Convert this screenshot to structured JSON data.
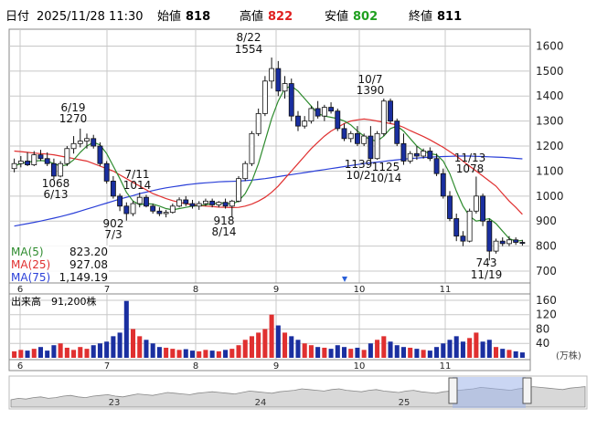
{
  "header": {
    "date_label": "日付",
    "date_value": "2025/11/28 11:30",
    "open_label": "始値",
    "open_value": "818",
    "high_label": "高値",
    "high_value": "822",
    "low_label": "安値",
    "low_value": "802",
    "close_label": "終値",
    "close_value": "811"
  },
  "colors": {
    "up": "#ffffff",
    "down": "#1a2fa0",
    "ma5": "#2e8b2e",
    "ma25": "#e03030",
    "ma75": "#2a3fd8",
    "vol_up": "#e03030",
    "vol_down": "#1a2fa0",
    "grid": "#c8c8c8",
    "high_text": "#e02020",
    "low_text": "#20a020"
  },
  "ma_legend": [
    {
      "label": "MA(5)",
      "value": "823.20"
    },
    {
      "label": "MA(25)",
      "value": "927.08"
    },
    {
      "label": "MA(75)",
      "value": "1,149.19"
    }
  ],
  "volume_label": "出来高",
  "volume_value": "91,200株",
  "volume_unit": "(万株)",
  "chart_data": {
    "type": "candlestick",
    "price_axis": {
      "ticks": [
        1600,
        1500,
        1400,
        1300,
        1200,
        1100,
        1000,
        900,
        800,
        700
      ],
      "range": [
        660,
        1660
      ]
    },
    "volume_axis": {
      "ticks": [
        160,
        120,
        80,
        40
      ],
      "range": [
        0,
        170
      ]
    },
    "month_labels": [
      "6",
      "7",
      "8",
      "9",
      "10",
      "11"
    ],
    "navigator_labels": [
      "23",
      "24",
      "25"
    ],
    "annotations": [
      {
        "date": "6/19",
        "value": "1270"
      },
      {
        "date": "6/13",
        "value": "1068"
      },
      {
        "date": "7/11",
        "value": "1014"
      },
      {
        "date": "7/3",
        "value": "902"
      },
      {
        "date": "8/14",
        "value": "918"
      },
      {
        "date": "8/22",
        "value": "1554"
      },
      {
        "date": "10/7",
        "value": "1390"
      },
      {
        "date": "10/2",
        "value": "1139"
      },
      {
        "date": "10/14",
        "value": "1125"
      },
      {
        "date": "11/13",
        "value": "1078"
      },
      {
        "date": "11/19",
        "value": "743"
      }
    ],
    "ohlc": [
      [
        1110,
        1150,
        1095,
        1130
      ],
      [
        1130,
        1160,
        1115,
        1140
      ],
      [
        1140,
        1175,
        1120,
        1125
      ],
      [
        1125,
        1180,
        1120,
        1165
      ],
      [
        1165,
        1185,
        1140,
        1150
      ],
      [
        1150,
        1175,
        1120,
        1130
      ],
      [
        1130,
        1150,
        1068,
        1080
      ],
      [
        1080,
        1140,
        1075,
        1130
      ],
      [
        1130,
        1200,
        1120,
        1190
      ],
      [
        1190,
        1240,
        1170,
        1210
      ],
      [
        1210,
        1270,
        1195,
        1220
      ],
      [
        1220,
        1250,
        1190,
        1230
      ],
      [
        1230,
        1245,
        1190,
        1200
      ],
      [
        1200,
        1215,
        1120,
        1130
      ],
      [
        1130,
        1140,
        1050,
        1060
      ],
      [
        1060,
        1080,
        990,
        1000
      ],
      [
        1000,
        1010,
        940,
        960
      ],
      [
        960,
        975,
        902,
        930
      ],
      [
        930,
        980,
        920,
        970
      ],
      [
        970,
        1014,
        955,
        995
      ],
      [
        995,
        1005,
        955,
        960
      ],
      [
        960,
        970,
        930,
        940
      ],
      [
        940,
        955,
        920,
        930
      ],
      [
        930,
        945,
        915,
        935
      ],
      [
        935,
        970,
        930,
        960
      ],
      [
        960,
        995,
        955,
        985
      ],
      [
        985,
        1000,
        960,
        970
      ],
      [
        970,
        985,
        950,
        960
      ],
      [
        960,
        980,
        945,
        970
      ],
      [
        970,
        990,
        960,
        980
      ],
      [
        980,
        990,
        955,
        965
      ],
      [
        965,
        980,
        955,
        975
      ],
      [
        975,
        990,
        950,
        960
      ],
      [
        960,
        985,
        918,
        980
      ],
      [
        980,
        1080,
        975,
        1070
      ],
      [
        1070,
        1140,
        1060,
        1130
      ],
      [
        1130,
        1260,
        1120,
        1250
      ],
      [
        1250,
        1350,
        1240,
        1330
      ],
      [
        1330,
        1480,
        1320,
        1460
      ],
      [
        1460,
        1554,
        1430,
        1510
      ],
      [
        1510,
        1540,
        1400,
        1420
      ],
      [
        1420,
        1480,
        1390,
        1450
      ],
      [
        1450,
        1470,
        1300,
        1320
      ],
      [
        1320,
        1340,
        1260,
        1280
      ],
      [
        1280,
        1320,
        1270,
        1300
      ],
      [
        1300,
        1360,
        1290,
        1350
      ],
      [
        1350,
        1380,
        1310,
        1320
      ],
      [
        1320,
        1365,
        1300,
        1355
      ],
      [
        1355,
        1375,
        1330,
        1340
      ],
      [
        1340,
        1350,
        1260,
        1270
      ],
      [
        1270,
        1290,
        1220,
        1230
      ],
      [
        1230,
        1260,
        1215,
        1250
      ],
      [
        1250,
        1280,
        1200,
        1210
      ],
      [
        1210,
        1250,
        1200,
        1240
      ],
      [
        1240,
        1280,
        1139,
        1150
      ],
      [
        1150,
        1260,
        1145,
        1250
      ],
      [
        1250,
        1390,
        1240,
        1380
      ],
      [
        1380,
        1390,
        1290,
        1300
      ],
      [
        1300,
        1310,
        1200,
        1210
      ],
      [
        1210,
        1250,
        1125,
        1140
      ],
      [
        1140,
        1180,
        1130,
        1170
      ],
      [
        1170,
        1200,
        1145,
        1160
      ],
      [
        1160,
        1190,
        1150,
        1180
      ],
      [
        1180,
        1195,
        1140,
        1150
      ],
      [
        1150,
        1170,
        1080,
        1090
      ],
      [
        1090,
        1110,
        990,
        1000
      ],
      [
        1000,
        1020,
        900,
        910
      ],
      [
        910,
        930,
        820,
        840
      ],
      [
        840,
        860,
        800,
        820
      ],
      [
        820,
        950,
        815,
        940
      ],
      [
        940,
        1078,
        930,
        1000
      ],
      [
        1000,
        1010,
        880,
        900
      ],
      [
        900,
        910,
        743,
        780
      ],
      [
        780,
        830,
        770,
        820
      ],
      [
        820,
        835,
        800,
        810
      ],
      [
        810,
        840,
        800,
        825
      ],
      [
        825,
        835,
        805,
        815
      ],
      [
        815,
        825,
        802,
        811
      ]
    ],
    "ma5": [
      1120,
      1130,
      1135,
      1140,
      1142,
      1140,
      1130,
      1120,
      1125,
      1145,
      1175,
      1200,
      1215,
      1205,
      1170,
      1120,
      1070,
      1015,
      980,
      965,
      970,
      968,
      960,
      950,
      945,
      950,
      955,
      960,
      962,
      965,
      970,
      972,
      972,
      968,
      980,
      1010,
      1060,
      1130,
      1220,
      1310,
      1380,
      1430,
      1440,
      1420,
      1390,
      1360,
      1330,
      1320,
      1315,
      1310,
      1300,
      1285,
      1260,
      1240,
      1225,
      1220,
      1240,
      1270,
      1280,
      1260,
      1230,
      1200,
      1180,
      1170,
      1165,
      1140,
      1090,
      1020,
      960,
      920,
      900,
      905,
      910,
      890,
      860,
      830,
      820,
      823
    ],
    "ma25": [
      1180,
      1178,
      1175,
      1172,
      1170,
      1168,
      1165,
      1160,
      1155,
      1150,
      1145,
      1140,
      1130,
      1120,
      1110,
      1100,
      1085,
      1070,
      1055,
      1040,
      1025,
      1010,
      1000,
      990,
      982,
      975,
      970,
      965,
      962,
      960,
      958,
      956,
      955,
      954,
      955,
      960,
      968,
      980,
      995,
      1015,
      1040,
      1070,
      1100,
      1130,
      1160,
      1190,
      1215,
      1240,
      1260,
      1275,
      1290,
      1300,
      1305,
      1308,
      1305,
      1300,
      1295,
      1290,
      1285,
      1275,
      1262,
      1250,
      1238,
      1225,
      1210,
      1195,
      1178,
      1160,
      1140,
      1120,
      1100,
      1080,
      1060,
      1040,
      1010,
      980,
      955,
      927
    ],
    "ma75": [
      880,
      885,
      890,
      895,
      900,
      906,
      912,
      918,
      925,
      932,
      940,
      948,
      956,
      964,
      972,
      980,
      988,
      995,
      1002,
      1010,
      1016,
      1022,
      1028,
      1033,
      1037,
      1041,
      1045,
      1048,
      1051,
      1053,
      1055,
      1057,
      1058,
      1059,
      1060,
      1062,
      1064,
      1067,
      1070,
      1074,
      1078,
      1082,
      1086,
      1090,
      1094,
      1098,
      1102,
      1106,
      1110,
      1114,
      1118,
      1122,
      1126,
      1130,
      1133,
      1136,
      1139,
      1142,
      1145,
      1148,
      1150,
      1152,
      1154,
      1156,
      1157,
      1158,
      1159,
      1160,
      1160,
      1160,
      1159,
      1158,
      1157,
      1156,
      1155,
      1153,
      1151,
      1149
    ],
    "volume": [
      18,
      22,
      20,
      25,
      30,
      20,
      35,
      40,
      28,
      22,
      30,
      25,
      35,
      40,
      45,
      60,
      70,
      158,
      80,
      60,
      50,
      40,
      30,
      28,
      25,
      22,
      24,
      20,
      18,
      22,
      20,
      18,
      22,
      25,
      35,
      50,
      60,
      70,
      80,
      120,
      90,
      70,
      60,
      50,
      40,
      35,
      30,
      28,
      25,
      35,
      30,
      25,
      28,
      22,
      40,
      50,
      60,
      45,
      35,
      30,
      28,
      25,
      22,
      20,
      30,
      40,
      50,
      60,
      45,
      55,
      70,
      45,
      50,
      30,
      25,
      22,
      18,
      15
    ],
    "navigator": [
      30,
      32,
      31,
      33,
      34,
      32,
      33,
      35,
      36,
      34,
      33,
      35,
      36,
      37,
      35,
      34,
      36,
      38,
      37,
      36,
      38,
      40,
      39,
      38,
      37,
      39,
      40,
      41,
      40,
      39,
      38,
      40,
      42,
      41,
      40,
      39,
      41,
      42,
      43,
      45,
      44,
      43,
      42,
      44,
      45,
      43,
      42,
      41,
      43,
      44,
      42,
      41,
      40,
      42,
      43,
      41,
      40,
      39,
      41,
      42,
      43,
      44,
      45,
      47,
      46,
      45,
      44,
      43,
      45,
      46,
      48,
      47,
      46,
      45,
      44,
      46,
      47,
      48
    ]
  }
}
